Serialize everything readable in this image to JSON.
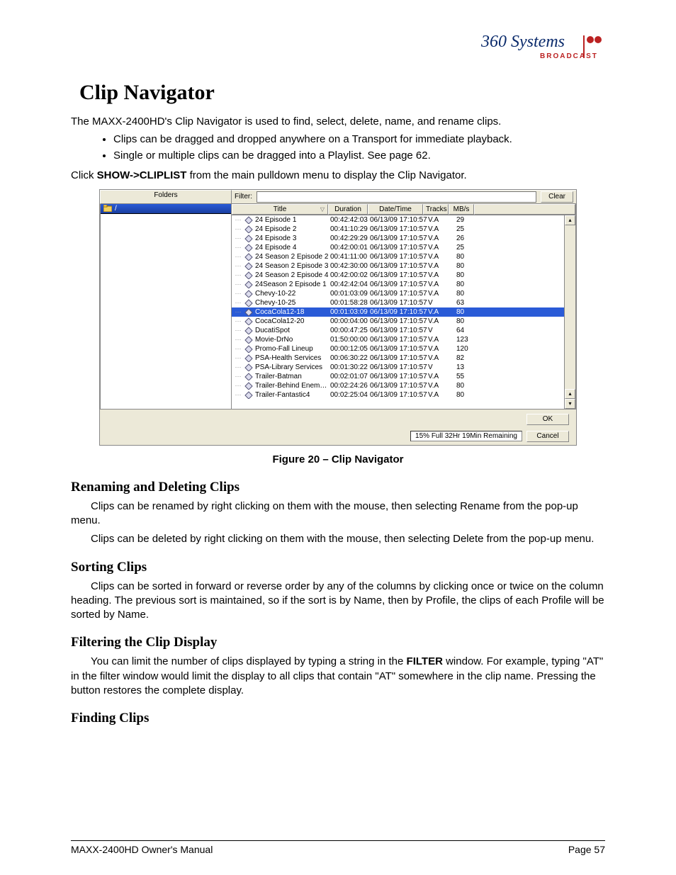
{
  "logo": {
    "brand_top": "360 Systems",
    "brand_sub": "BROADCAST"
  },
  "h1": "Clip Navigator",
  "intro": "The MAXX-2400HD's Clip Navigator is used to find, select, delete, name, and rename clips.",
  "bullets": [
    "Clips can be dragged and dropped anywhere on a Transport for immediate playback.",
    "Single or multiple clips can be dragged into a Playlist.  See page 62."
  ],
  "click_line_pre": "Click ",
  "click_line_bold": "SHOW->CLIPLIST",
  "click_line_post": " from the main pulldown menu to display the Clip Navigator.",
  "caption": "Figure 20 – Clip Navigator",
  "shot": {
    "folders_header": "Folders",
    "filter_label": "Filter:",
    "clear_btn": "Clear",
    "folders_root": "/",
    "columns": {
      "title": "Title",
      "duration": "Duration",
      "datetime": "Date/Time",
      "tracks": "Tracks",
      "mbs": "MB/s"
    },
    "clips": [
      {
        "title": "24 Episode 1",
        "dur": "00:42:42:03",
        "dt": "06/13/09 17:10:57",
        "trk": "V.A",
        "mb": "29"
      },
      {
        "title": "24 Episode 2",
        "dur": "00:41:10:29",
        "dt": "06/13/09 17:10:57",
        "trk": "V.A",
        "mb": "25"
      },
      {
        "title": "24 Episode 3",
        "dur": "00:42:29:29",
        "dt": "06/13/09 17:10:57",
        "trk": "V.A",
        "mb": "26"
      },
      {
        "title": "24 Episode 4",
        "dur": "00:42:00:01",
        "dt": "06/13/09 17:10:57",
        "trk": "V.A",
        "mb": "25"
      },
      {
        "title": "24 Season 2 Episode 2",
        "dur": "00:41:11:00",
        "dt": "06/13/09 17:10:57",
        "trk": "V.A",
        "mb": "80"
      },
      {
        "title": "24 Season 2 Episode 3",
        "dur": "00:42:30:00",
        "dt": "06/13/09 17:10:57",
        "trk": "V.A",
        "mb": "80"
      },
      {
        "title": "24 Season 2 Episode 4",
        "dur": "00:42:00:02",
        "dt": "06/13/09 17:10:57",
        "trk": "V.A",
        "mb": "80"
      },
      {
        "title": "24Season 2 Episode 1",
        "dur": "00:42:42:04",
        "dt": "06/13/09 17:10:57",
        "trk": "V.A",
        "mb": "80"
      },
      {
        "title": "Chevy-10-22",
        "dur": "00:01:03:09",
        "dt": "06/13/09 17:10:57",
        "trk": "V.A",
        "mb": "80"
      },
      {
        "title": "Chevy-10-25",
        "dur": "00:01:58:28",
        "dt": "06/13/09 17:10:57",
        "trk": "V",
        "mb": "63"
      },
      {
        "title": "CocaCola12-18",
        "dur": "00:01:03:09",
        "dt": "06/13/09 17:10:57",
        "trk": "V.A",
        "mb": "80",
        "selected": true
      },
      {
        "title": "CocaCola12-20",
        "dur": "00:00:04:00",
        "dt": "06/13/09 17:10:57",
        "trk": "V.A",
        "mb": "80"
      },
      {
        "title": "DucatiSpot",
        "dur": "00:00:47:25",
        "dt": "06/13/09 17:10:57",
        "trk": "V",
        "mb": "64"
      },
      {
        "title": "Movie-DrNo",
        "dur": "01:50:00:00",
        "dt": "06/13/09 17:10:57",
        "trk": "V.A",
        "mb": "123"
      },
      {
        "title": "Promo-Fall Lineup",
        "dur": "00:00:12:05",
        "dt": "06/13/09 17:10:57",
        "trk": "V.A",
        "mb": "120"
      },
      {
        "title": "PSA-Health Services",
        "dur": "00:06:30:22",
        "dt": "06/13/09 17:10:57",
        "trk": "V.A",
        "mb": "82"
      },
      {
        "title": "PSA-Library Services",
        "dur": "00:01:30:22",
        "dt": "06/13/09 17:10:57",
        "trk": "V",
        "mb": "13"
      },
      {
        "title": "Trailer-Batman",
        "dur": "00:02:01:07",
        "dt": "06/13/09 17:10:57",
        "trk": "V.A",
        "mb": "55"
      },
      {
        "title": "Trailer-Behind Enemy Lines",
        "dur": "00:02:24:26",
        "dt": "06/13/09 17:10:57",
        "trk": "V.A",
        "mb": "80"
      },
      {
        "title": "Trailer-Fantastic4",
        "dur": "00:02:25:04",
        "dt": "06/13/09 17:10:57",
        "trk": "V.A",
        "mb": "80"
      }
    ],
    "status": "15% Full  32Hr 19Min Remaining",
    "ok_btn": "OK",
    "cancel_btn": "Cancel"
  },
  "sections": {
    "rename_h": "Renaming and Deleting Clips",
    "rename_p1": "Clips can be renamed by right clicking on them with the mouse, then selecting Rename from the pop-up menu.",
    "rename_p2": "Clips can be deleted by right clicking on them with the mouse, then selecting Delete from the pop-up menu.",
    "sort_h": "Sorting Clips",
    "sort_p": "Clips can be sorted in forward or reverse order by any of the columns by clicking once or twice on the column heading. The previous sort is maintained, so if the sort is by Name, then by Profile, the clips of each Profile will be sorted by Name.",
    "filter_h": "Filtering the Clip Display",
    "filter_p_pre": "You can limit the number of clips displayed by typing a string in the ",
    "filter_p_bold": "FILTER",
    "filter_p_post": " window. For example, typing \"AT\" in the filter window would limit the display to all clips that contain \"AT\" somewhere in the clip name. Pressing the            button restores the complete display.",
    "find_h": "Finding Clips"
  },
  "footer": {
    "left": "MAXX-2400HD Owner's Manual",
    "right": "Page 57"
  }
}
